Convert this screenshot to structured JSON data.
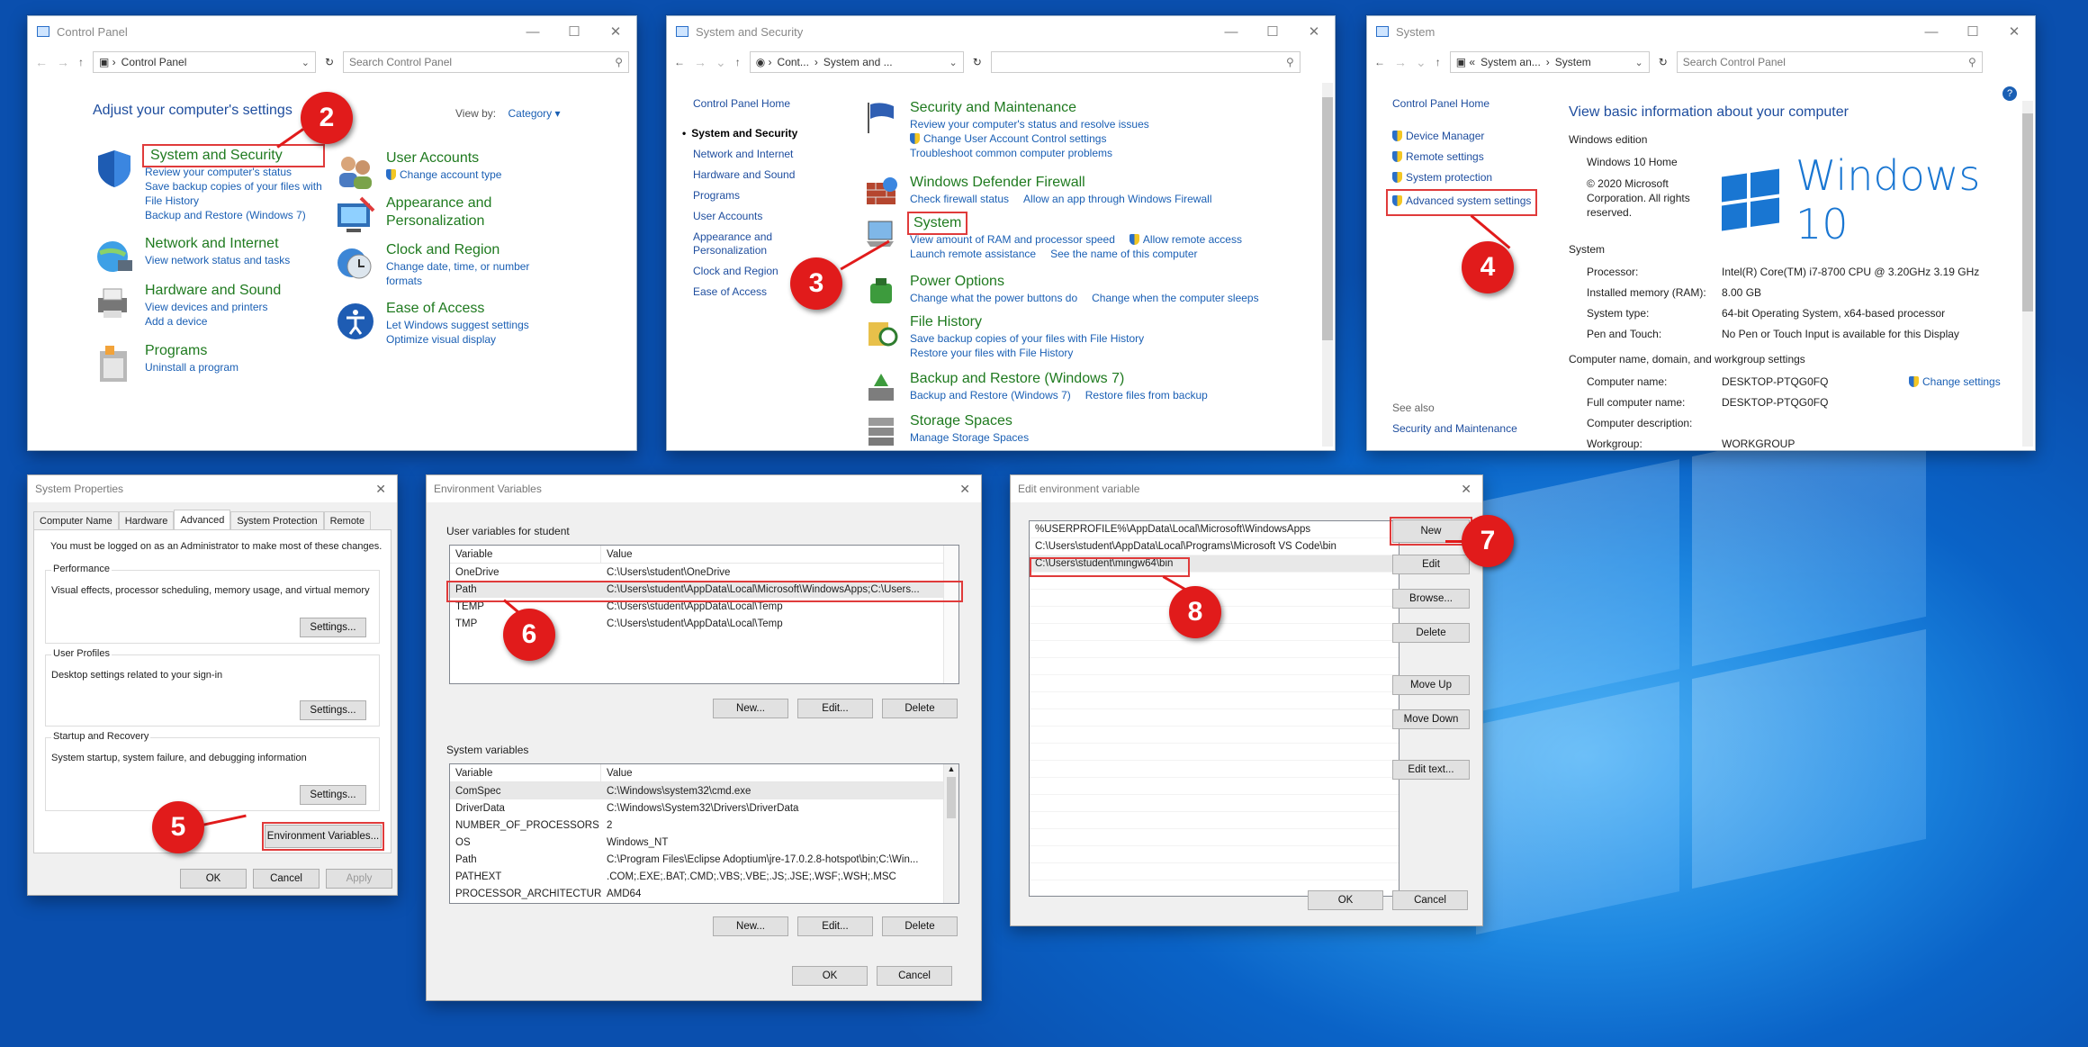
{
  "colors": {
    "accent": "#1a5fb4",
    "badge": "#e11b1b",
    "heading_green": "#1f7a1f",
    "desktop": "#0a63c7"
  },
  "cp": {
    "title": "Control Panel",
    "address": "Control Panel",
    "search": "Search Control Panel",
    "heading": "Adjust your computer's settings",
    "viewby": "View by:",
    "category": "Category",
    "sys_sec": {
      "title": "System and Security",
      "l1": "Review your computer's status",
      "l2": "Save backup copies of your files with",
      "l3": "File History",
      "l4": "Backup and Restore (Windows 7)"
    },
    "net": {
      "title": "Network and Internet",
      "l1": "View network status and tasks"
    },
    "hw": {
      "title": "Hardware and Sound",
      "l1": "View devices and printers",
      "l2": "Add a device"
    },
    "prog": {
      "title": "Programs",
      "l1": "Uninstall a program"
    },
    "users": {
      "title": "User Accounts",
      "l1": "Change account type"
    },
    "appear": {
      "title": "Appearance and",
      "title2": "Personalization"
    },
    "clock": {
      "title": "Clock and Region",
      "l1": "Change date, time, or number",
      "l2": "formats"
    },
    "ease": {
      "title": "Ease of Access",
      "l1": "Let Windows suggest settings",
      "l2": "Optimize visual display"
    }
  },
  "ss": {
    "title": "System and Security",
    "address1": "Cont...",
    "address2": "System and ...",
    "sidebar": [
      "Control Panel Home",
      "System and Security",
      "Network and Internet",
      "Hardware and Sound",
      "Programs",
      "User Accounts",
      "Appearance and",
      "Personalization",
      "Clock and Region",
      "Ease of Access"
    ],
    "maint": {
      "title": "Security and Maintenance",
      "l1": "Review your computer's status and resolve issues",
      "l2": "Change User Account Control settings",
      "l3": "Troubleshoot common computer problems"
    },
    "fw": {
      "title": "Windows Defender Firewall",
      "l1": "Check firewall status",
      "l2": "Allow an app through Windows Firewall"
    },
    "sys": {
      "title": "System",
      "l1": "View amount of RAM and processor speed",
      "l2": "Allow remote access",
      "l3": "Launch remote assistance",
      "l4": "See the name of this computer"
    },
    "power": {
      "title": "Power Options",
      "l1": "Change what the power buttons do",
      "l2": "Change when the computer sleeps"
    },
    "fh": {
      "title": "File History",
      "l1": "Save backup copies of your files with File History",
      "l2": "Restore your files with File History"
    },
    "br": {
      "title": "Backup and Restore (Windows 7)",
      "l1": "Backup and Restore (Windows 7)",
      "l2": "Restore files from backup"
    },
    "stor": {
      "title": "Storage Spaces",
      "l1": "Manage Storage Spaces"
    }
  },
  "sysw": {
    "title": "System",
    "address1": "System an...",
    "address2": "System",
    "search": "Search Control Panel",
    "home": "Control Panel Home",
    "links": [
      "Device Manager",
      "Remote settings",
      "System protection",
      "Advanced system settings"
    ],
    "seealso": "See also",
    "seealso_link": "Security and Maintenance",
    "heading": "View basic information about your computer",
    "edition": "Windows edition",
    "ed_name": "Windows 10 Home",
    "copyright": "© 2020 Microsoft Corporation. All rights reserved.",
    "logo_text": "Windows 10",
    "system": "System",
    "rows": [
      {
        "k": "Processor:",
        "v": "Intel(R) Core(TM) i7-8700 CPU @ 3.20GHz   3.19 GHz"
      },
      {
        "k": "Installed memory (RAM):",
        "v": "8.00 GB"
      },
      {
        "k": "System type:",
        "v": "64-bit Operating System, x64-based processor"
      },
      {
        "k": "Pen and Touch:",
        "v": "No Pen or Touch Input is available for this Display"
      }
    ],
    "cn": "Computer name, domain, and workgroup settings",
    "rows2": [
      {
        "k": "Computer name:",
        "v": "DESKTOP-PTQG0FQ"
      },
      {
        "k": "Full computer name:",
        "v": "DESKTOP-PTQG0FQ"
      },
      {
        "k": "Computer description:",
        "v": ""
      },
      {
        "k": "Workgroup:",
        "v": "WORKGROUP"
      }
    ],
    "change": "Change settings"
  },
  "sp": {
    "title": "System Properties",
    "tabs": [
      "Computer Name",
      "Hardware",
      "Advanced",
      "System Protection",
      "Remote"
    ],
    "admin": "You must be logged on as an Administrator to make most of these changes.",
    "perf": "Performance",
    "perf_d": "Visual effects, processor scheduling, memory usage, and virtual memory",
    "up": "User Profiles",
    "up_d": "Desktop settings related to your sign-in",
    "sr": "Startup and Recovery",
    "sr_d": "System startup, system failure, and debugging information",
    "settings": "Settings...",
    "env": "Environment Variables...",
    "ok": "OK",
    "cancel": "Cancel",
    "apply": "Apply"
  },
  "ev": {
    "title": "Environment Variables",
    "user_label": "User variables for student",
    "col_var": "Variable",
    "col_val": "Value",
    "user": [
      {
        "n": "OneDrive",
        "v": "C:\\Users\\student\\OneDrive"
      },
      {
        "n": "Path",
        "v": "C:\\Users\\student\\AppData\\Local\\Microsoft\\WindowsApps;C:\\Users..."
      },
      {
        "n": "TEMP",
        "v": "C:\\Users\\student\\AppData\\Local\\Temp"
      },
      {
        "n": "TMP",
        "v": "C:\\Users\\student\\AppData\\Local\\Temp"
      }
    ],
    "sys_label": "System variables",
    "sys": [
      {
        "n": "ComSpec",
        "v": "C:\\Windows\\system32\\cmd.exe"
      },
      {
        "n": "DriverData",
        "v": "C:\\Windows\\System32\\Drivers\\DriverData"
      },
      {
        "n": "NUMBER_OF_PROCESSORS",
        "v": "2"
      },
      {
        "n": "OS",
        "v": "Windows_NT"
      },
      {
        "n": "Path",
        "v": "C:\\Program Files\\Eclipse Adoptium\\jre-17.0.2.8-hotspot\\bin;C:\\Win..."
      },
      {
        "n": "PATHEXT",
        "v": ".COM;.EXE;.BAT;.CMD;.VBS;.VBE;.JS;.JSE;.WSF;.WSH;.MSC"
      },
      {
        "n": "PROCESSOR_ARCHITECTURE",
        "v": "AMD64"
      }
    ],
    "new": "New...",
    "edit": "Edit...",
    "delete": "Delete",
    "ok": "OK",
    "cancel": "Cancel"
  },
  "ee": {
    "title": "Edit environment variable",
    "items": [
      "%USERPROFILE%\\AppData\\Local\\Microsoft\\WindowsApps",
      "C:\\Users\\student\\AppData\\Local\\Programs\\Microsoft VS Code\\bin",
      "C:\\Users\\student\\mingw64\\bin"
    ],
    "new": "New",
    "edit": "Edit",
    "browse": "Browse...",
    "delete": "Delete",
    "up": "Move Up",
    "down": "Move Down",
    "edittext": "Edit text...",
    "ok": "OK",
    "cancel": "Cancel"
  },
  "badges": [
    "2",
    "3",
    "4",
    "5",
    "6",
    "7",
    "8"
  ]
}
